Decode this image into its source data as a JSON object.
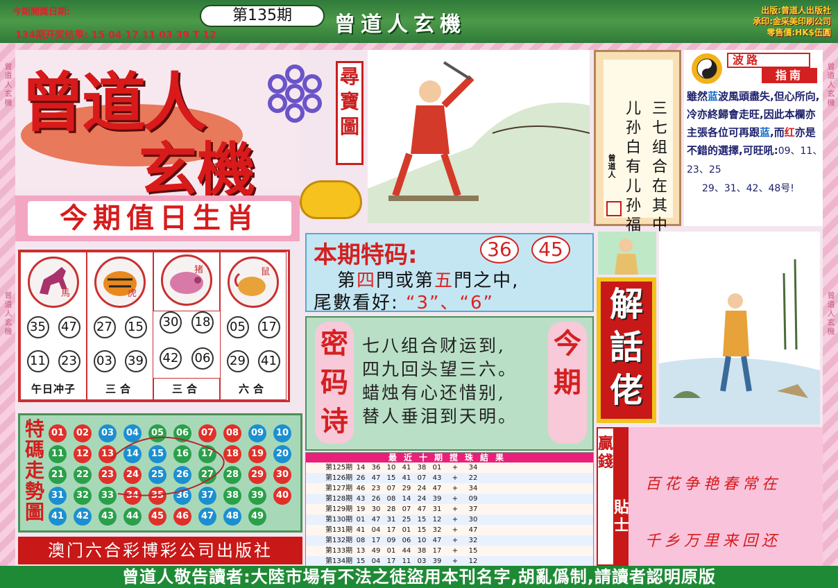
{
  "header": {
    "open_date_label": "今期開獎日期:",
    "last_result": "134期开奖结果: 15 04 17 11 03 39 T 12",
    "issue": "第135期",
    "title": "曾道人玄機",
    "publisher_lines": [
      "出版:曾道人出版社",
      "承印:金采美印刷公司",
      "零售價:HK$伍圓"
    ]
  },
  "border_text": "曾道人玄機",
  "logo": {
    "line1": "曾道人",
    "line2": "玄機",
    "treasure_map": "尋寶圖"
  },
  "zodiac": {
    "title": "今期值日生肖",
    "cells": [
      {
        "animal": "馬",
        "icon": "horse-icon",
        "numbers": [
          "35",
          "47",
          "11",
          "23"
        ],
        "footer": "午日冲子"
      },
      {
        "animal": "虎",
        "icon": "tiger-icon",
        "numbers": [
          "27",
          "15",
          "03",
          "39"
        ],
        "footer": "三合"
      },
      {
        "animal": "猪",
        "icon": "pig-icon",
        "numbers": [
          "30",
          "18",
          "42",
          "06"
        ],
        "footer": "三合"
      },
      {
        "animal": "鼠",
        "icon": "rat-icon",
        "numbers": [
          "05",
          "17",
          "29",
          "41"
        ],
        "footer": "六合"
      }
    ]
  },
  "trend": {
    "label": "特碼走勢圖",
    "balls": [
      {
        "n": "01",
        "c": "#e0302a"
      },
      {
        "n": "02",
        "c": "#e0302a"
      },
      {
        "n": "03",
        "c": "#1c8fd1"
      },
      {
        "n": "04",
        "c": "#1c8fd1"
      },
      {
        "n": "05",
        "c": "#2ba04a"
      },
      {
        "n": "06",
        "c": "#2ba04a"
      },
      {
        "n": "07",
        "c": "#e0302a"
      },
      {
        "n": "08",
        "c": "#e0302a"
      },
      {
        "n": "09",
        "c": "#1c8fd1"
      },
      {
        "n": "10",
        "c": "#1c8fd1"
      },
      {
        "n": "11",
        "c": "#2ba04a"
      },
      {
        "n": "12",
        "c": "#e0302a"
      },
      {
        "n": "13",
        "c": "#e0302a"
      },
      {
        "n": "14",
        "c": "#1c8fd1"
      },
      {
        "n": "15",
        "c": "#1c8fd1"
      },
      {
        "n": "16",
        "c": "#2ba04a"
      },
      {
        "n": "17",
        "c": "#2ba04a"
      },
      {
        "n": "18",
        "c": "#e0302a"
      },
      {
        "n": "19",
        "c": "#e0302a"
      },
      {
        "n": "20",
        "c": "#1c8fd1"
      },
      {
        "n": "21",
        "c": "#2ba04a"
      },
      {
        "n": "22",
        "c": "#2ba04a"
      },
      {
        "n": "23",
        "c": "#e0302a"
      },
      {
        "n": "24",
        "c": "#e0302a"
      },
      {
        "n": "25",
        "c": "#1c8fd1"
      },
      {
        "n": "26",
        "c": "#1c8fd1"
      },
      {
        "n": "27",
        "c": "#2ba04a"
      },
      {
        "n": "28",
        "c": "#2ba04a"
      },
      {
        "n": "29",
        "c": "#e0302a"
      },
      {
        "n": "30",
        "c": "#e0302a"
      },
      {
        "n": "31",
        "c": "#1c8fd1"
      },
      {
        "n": "32",
        "c": "#2ba04a"
      },
      {
        "n": "33",
        "c": "#2ba04a"
      },
      {
        "n": "34",
        "c": "#e0302a"
      },
      {
        "n": "35",
        "c": "#e0302a"
      },
      {
        "n": "36",
        "c": "#1c8fd1"
      },
      {
        "n": "37",
        "c": "#1c8fd1"
      },
      {
        "n": "38",
        "c": "#2ba04a"
      },
      {
        "n": "39",
        "c": "#2ba04a"
      },
      {
        "n": "40",
        "c": "#e0302a"
      },
      {
        "n": "41",
        "c": "#1c8fd1"
      },
      {
        "n": "42",
        "c": "#1c8fd1"
      },
      {
        "n": "43",
        "c": "#2ba04a"
      },
      {
        "n": "44",
        "c": "#2ba04a"
      },
      {
        "n": "45",
        "c": "#e0302a"
      },
      {
        "n": "46",
        "c": "#e0302a"
      },
      {
        "n": "47",
        "c": "#1c8fd1"
      },
      {
        "n": "48",
        "c": "#1c8fd1"
      },
      {
        "n": "49",
        "c": "#2ba04a"
      }
    ]
  },
  "macau_publisher": "澳门六合彩博彩公司出版社",
  "special": {
    "title": "本期特码:",
    "numbers": [
      "36",
      "45"
    ],
    "line1_a": "第",
    "line1_b": "四",
    "line1_c": "門或第",
    "line1_d": "五",
    "line1_e": "門之中,",
    "line2_a": "尾數看好:",
    "line2_b": "“3”、“6”"
  },
  "poem": {
    "tag_left": "密码诗",
    "tag_right": "今期",
    "lines": [
      "七八组合财运到,",
      "四九回头望三六。",
      "蜡烛有心还惜别,",
      "替人垂泪到天明。"
    ]
  },
  "results": {
    "title": "最近十期搅珠結果",
    "rows": [
      {
        "period": "第125期",
        "nums": [
          "14",
          "36",
          "10",
          "41",
          "38",
          "01"
        ],
        "sp": "34"
      },
      {
        "period": "第126期",
        "nums": [
          "26",
          "47",
          "15",
          "41",
          "07",
          "43"
        ],
        "sp": "22"
      },
      {
        "period": "第127期",
        "nums": [
          "46",
          "23",
          "07",
          "29",
          "24",
          "47"
        ],
        "sp": "34"
      },
      {
        "period": "第128期",
        "nums": [
          "43",
          "26",
          "08",
          "14",
          "24",
          "39"
        ],
        "sp": "09"
      },
      {
        "period": "第129期",
        "nums": [
          "19",
          "30",
          "28",
          "07",
          "47",
          "31"
        ],
        "sp": "37"
      },
      {
        "period": "第130期",
        "nums": [
          "01",
          "47",
          "31",
          "25",
          "15",
          "12"
        ],
        "sp": "30"
      },
      {
        "period": "第131期",
        "nums": [
          "41",
          "04",
          "17",
          "01",
          "15",
          "32"
        ],
        "sp": "47"
      },
      {
        "period": "第132期",
        "nums": [
          "08",
          "17",
          "09",
          "06",
          "10",
          "47"
        ],
        "sp": "32"
      },
      {
        "period": "第133期",
        "nums": [
          "13",
          "49",
          "01",
          "44",
          "38",
          "17"
        ],
        "sp": "15"
      },
      {
        "period": "第134期",
        "nums": [
          "15",
          "04",
          "17",
          "11",
          "03",
          "39"
        ],
        "sp": "12"
      }
    ],
    "plus": "+"
  },
  "verse": {
    "col_right": "三七组合在其中",
    "col_left": "儿孙白有儿孙福",
    "signature": "曾道人"
  },
  "wave": {
    "title_top": "波路",
    "title_bottom": "指南",
    "text_a": "雖然",
    "text_blue1": "蓝",
    "text_b": "波風頭盡失,但心所向,冷亦終歸會走旺,因此本欄亦主張各位可再跟",
    "text_blue2": "蓝",
    "text_c": ",而",
    "text_red": "红",
    "text_d": "亦是不錯的選擇,可旺吼:",
    "nums1": "09、11、23、25",
    "nums2": "29、31、42、48号!"
  },
  "jiehua": "解話佬",
  "win": {
    "tag1": "贏錢",
    "tag2": "貼士",
    "line1": "百花争艳春常在",
    "line2": "千乡万里来回还"
  },
  "footer": "曾道人敬告讀者:大陸市場有不法之徒盜用本刊名字,胡亂僞制,請讀者認明原版"
}
